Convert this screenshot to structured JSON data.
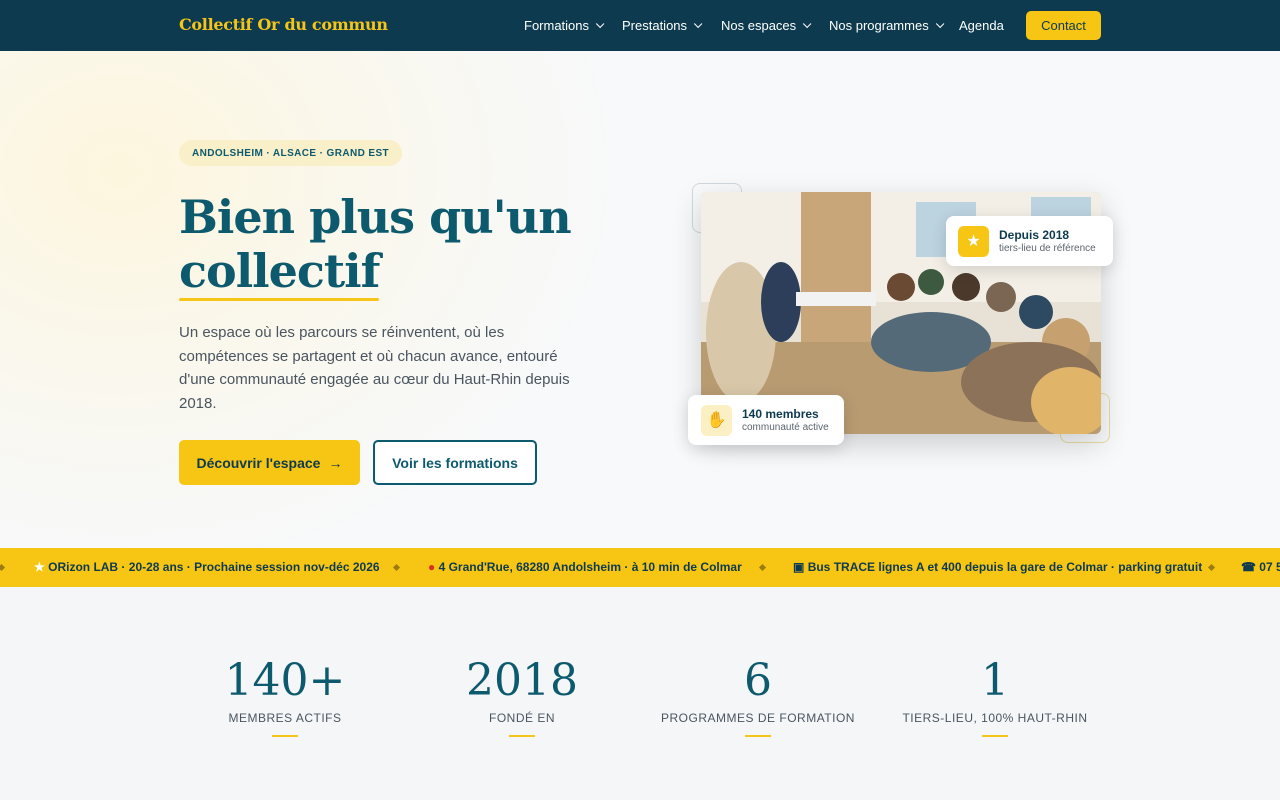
{
  "nav": {
    "brand": "Collectif Or du commun",
    "items": [
      {
        "label": "Formations"
      },
      {
        "label": "Prestations"
      },
      {
        "label": "Nos espaces"
      },
      {
        "label": "Nos programmes"
      },
      {
        "label": "Agenda"
      }
    ],
    "contact_label": "Contact"
  },
  "hero": {
    "badge": "ANDOLSHEIM · ALSACE · GRAND EST",
    "title_line1": "Bien plus qu'un",
    "title_line2": "collectif",
    "lead": "Un espace où les parcours se réinventent, où les compétences se partagent et où chacun avance, entouré d'une communauté engagée au cœur du Haut-Rhin depuis 2018.",
    "cta_primary": "Découvrir l'espace",
    "cta_secondary": "Voir les formations",
    "card_depuis": {
      "title": "Depuis 2018",
      "subtitle": "tiers-lieu de référence",
      "icon": "star-icon"
    },
    "card_membres": {
      "title": "140 membres",
      "subtitle": "communauté active",
      "icon": "handshake-icon"
    }
  },
  "ticker": {
    "items": [
      "ORizon LAB · 20-28 ans · Prochaine session nov-déc 2026",
      "4 Grand'Rue, 68280 Andolsheim · à 10 min de Colmar",
      "Bus TRACE lignes A et 400 depuis la gare de Colmar · parking gratuit",
      "07 5"
    ]
  },
  "stats": [
    {
      "value": "140+",
      "label": "MEMBRES ACTIFS"
    },
    {
      "value": "2018",
      "label": "FONDÉ EN"
    },
    {
      "value": "6",
      "label": "PROGRAMMES DE FORMATION"
    },
    {
      "value": "1",
      "label": "TIERS-LIEU, 100% HAUT-RHIN"
    }
  ],
  "colors": {
    "brand_dark": "#0d3a4e",
    "accent": "#f7c514",
    "teal": "#0d5a6e"
  }
}
